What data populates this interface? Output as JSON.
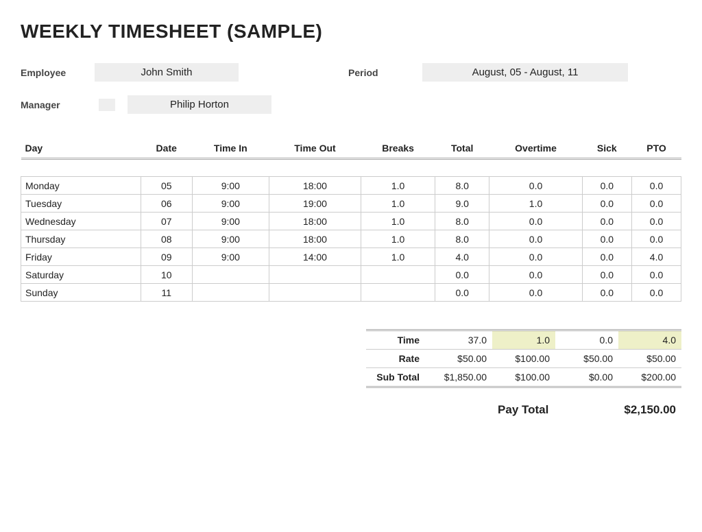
{
  "title": "WEEKLY TIMESHEET (SAMPLE)",
  "meta": {
    "employee_label": "Employee",
    "employee_value": "John Smith",
    "period_label": "Period",
    "period_value": "August, 05 - August, 11",
    "manager_label": "Manager",
    "manager_value": "Philip Horton"
  },
  "headers": {
    "day": "Day",
    "date": "Date",
    "time_in": "Time In",
    "time_out": "Time Out",
    "breaks": "Breaks",
    "total": "Total",
    "overtime": "Overtime",
    "sick": "Sick",
    "pto": "PTO"
  },
  "rows": [
    {
      "day": "Monday",
      "date": "05",
      "in": "9:00",
      "out": "18:00",
      "breaks": "1.0",
      "total": "8.0",
      "ot": "0.0",
      "sick": "0.0",
      "pto": "0.0"
    },
    {
      "day": "Tuesday",
      "date": "06",
      "in": "9:00",
      "out": "19:00",
      "breaks": "1.0",
      "total": "9.0",
      "ot": "1.0",
      "sick": "0.0",
      "pto": "0.0"
    },
    {
      "day": "Wednesday",
      "date": "07",
      "in": "9:00",
      "out": "18:00",
      "breaks": "1.0",
      "total": "8.0",
      "ot": "0.0",
      "sick": "0.0",
      "pto": "0.0"
    },
    {
      "day": "Thursday",
      "date": "08",
      "in": "9:00",
      "out": "18:00",
      "breaks": "1.0",
      "total": "8.0",
      "ot": "0.0",
      "sick": "0.0",
      "pto": "0.0"
    },
    {
      "day": "Friday",
      "date": "09",
      "in": "9:00",
      "out": "14:00",
      "breaks": "1.0",
      "total": "4.0",
      "ot": "0.0",
      "sick": "0.0",
      "pto": "4.0"
    },
    {
      "day": "Saturday",
      "date": "10",
      "in": "",
      "out": "",
      "breaks": "",
      "total": "0.0",
      "ot": "0.0",
      "sick": "0.0",
      "pto": "0.0"
    },
    {
      "day": "Sunday",
      "date": "11",
      "in": "",
      "out": "",
      "breaks": "",
      "total": "0.0",
      "ot": "0.0",
      "sick": "0.0",
      "pto": "0.0"
    }
  ],
  "summary": {
    "time_label": "Time",
    "time": {
      "total": "37.0",
      "ot": "1.0",
      "sick": "0.0",
      "pto": "4.0"
    },
    "rate_label": "Rate",
    "rate": {
      "total": "$50.00",
      "ot": "$100.00",
      "sick": "$50.00",
      "pto": "$50.00"
    },
    "subtotal_label": "Sub Total",
    "subtotal": {
      "total": "$1,850.00",
      "ot": "$100.00",
      "sick": "$0.00",
      "pto": "$200.00"
    }
  },
  "paytotal_label": "Pay Total",
  "paytotal_value": "$2,150.00"
}
